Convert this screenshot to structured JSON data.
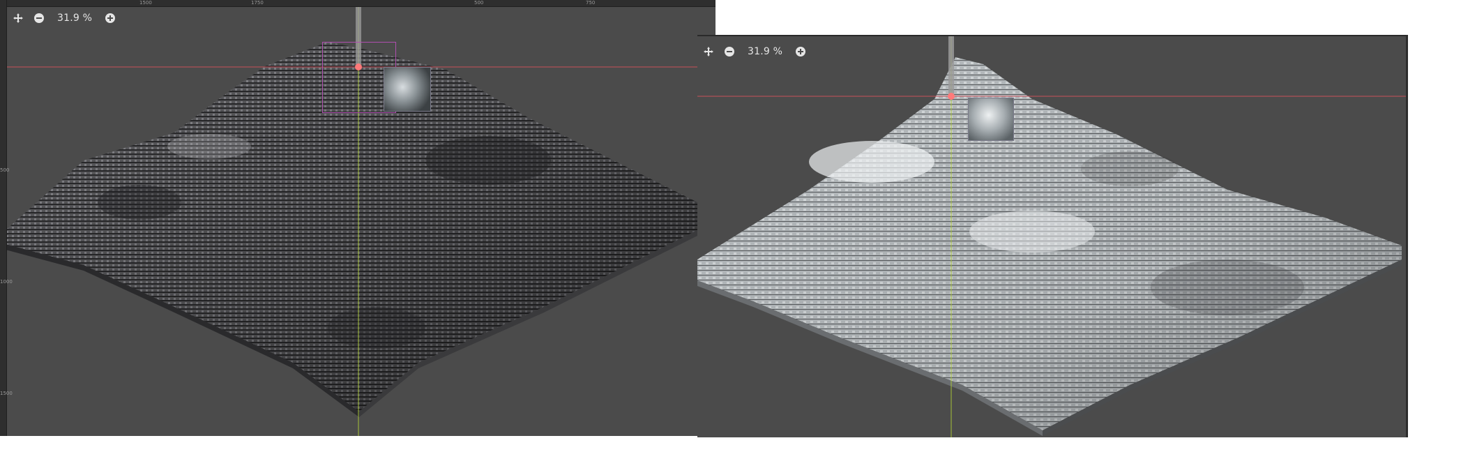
{
  "colors": {
    "viewport_bg": "#4b4b4b",
    "guide_horizontal": "#c8505a",
    "guide_vertical": "#a6c23a",
    "selection": "#b04fb0"
  },
  "viewports": [
    {
      "zoom_label": "31.9 %",
      "icons": [
        "move-gizmo-icon",
        "zoom-out-icon",
        "zoom-in-icon"
      ],
      "ruler_top_ticks": [
        "1500",
        "1750",
        "500",
        "750"
      ],
      "ruler_left_ticks": [
        "500",
        "1000",
        "1500"
      ],
      "terrain_style": "dark"
    },
    {
      "zoom_label": "31.9 %",
      "icons": [
        "move-gizmo-icon",
        "zoom-out-icon",
        "zoom-in-icon"
      ],
      "terrain_style": "light"
    }
  ]
}
